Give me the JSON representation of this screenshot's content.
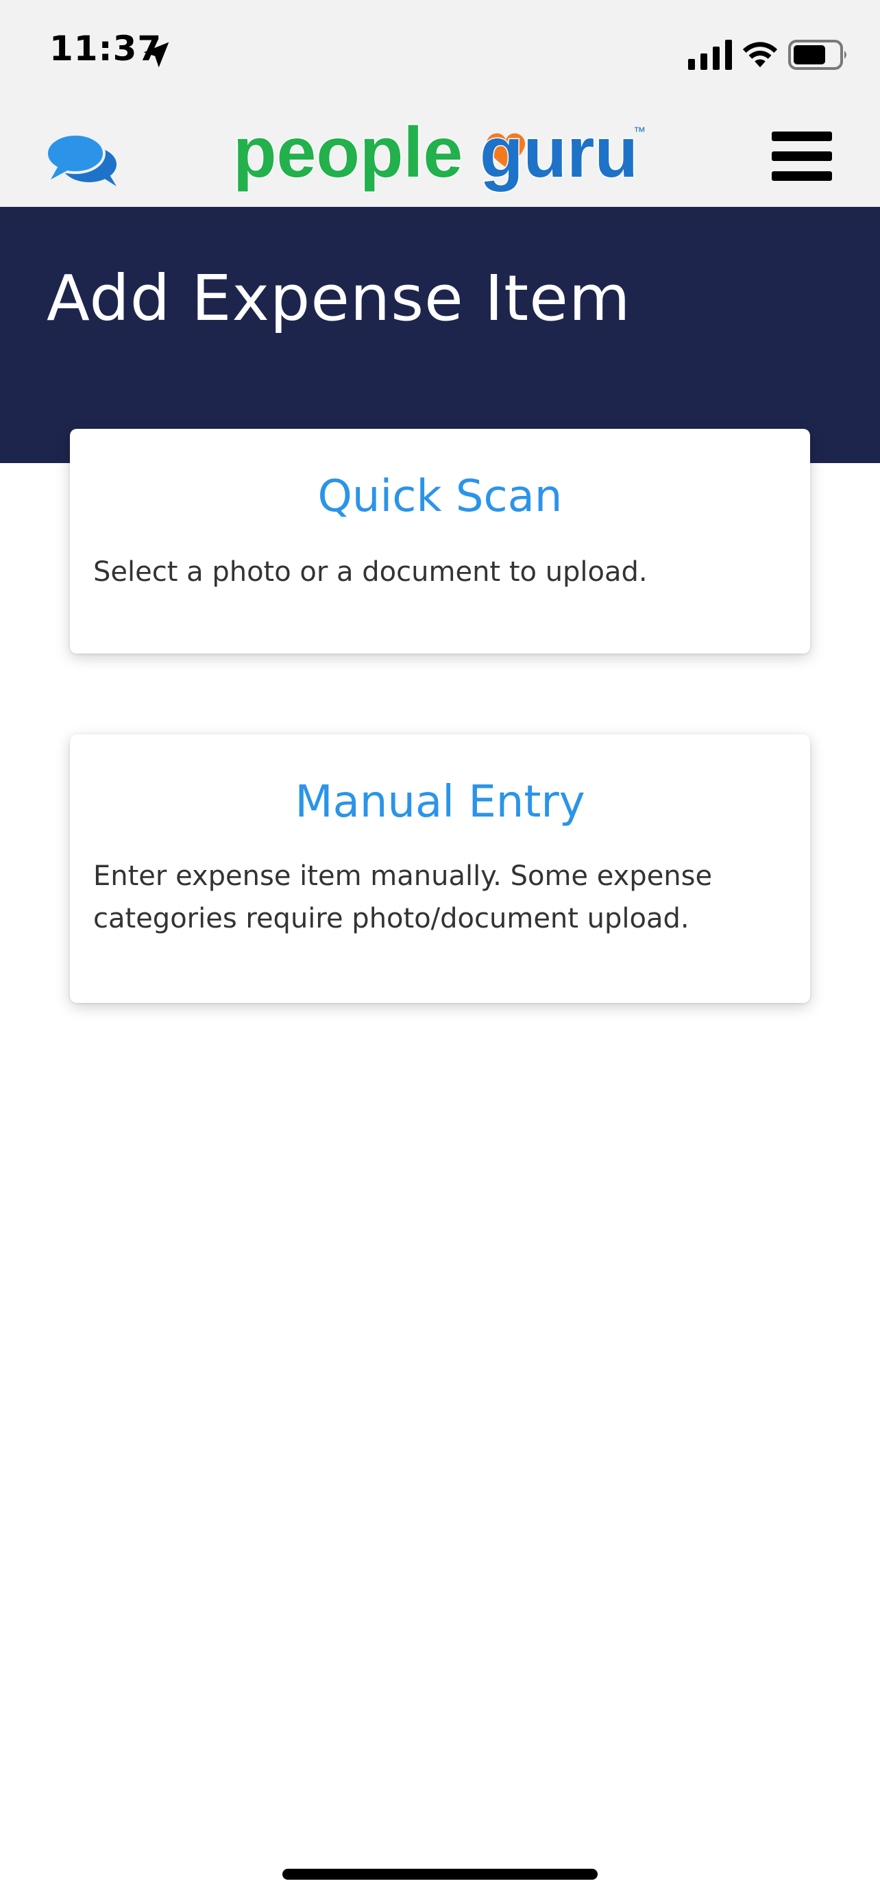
{
  "status_bar": {
    "time": "11:37",
    "location_icon": "location-arrow-icon",
    "signal_icon": "cellular-signal-icon",
    "wifi_icon": "wifi-icon",
    "battery_icon": "battery-icon",
    "battery_level": 0.7
  },
  "nav": {
    "chat_icon": "chat-bubbles-icon",
    "logo_text_left": "people",
    "logo_text_right": "guru",
    "logo_tm": "™",
    "menu_icon": "hamburger-menu-icon"
  },
  "header": {
    "title": "Add Expense Item"
  },
  "options": [
    {
      "title": "Quick Scan",
      "description": "Select a photo or a document to upload."
    },
    {
      "title": "Manual Entry",
      "description": "Enter expense item manually. Some expense categories require photo/document upload."
    }
  ],
  "colors": {
    "header_bg": "#1e254d",
    "accent_blue": "#2b94e8",
    "logo_green": "#22b14c",
    "logo_blue": "#1e73c8",
    "logo_heart": "#f47a20"
  }
}
